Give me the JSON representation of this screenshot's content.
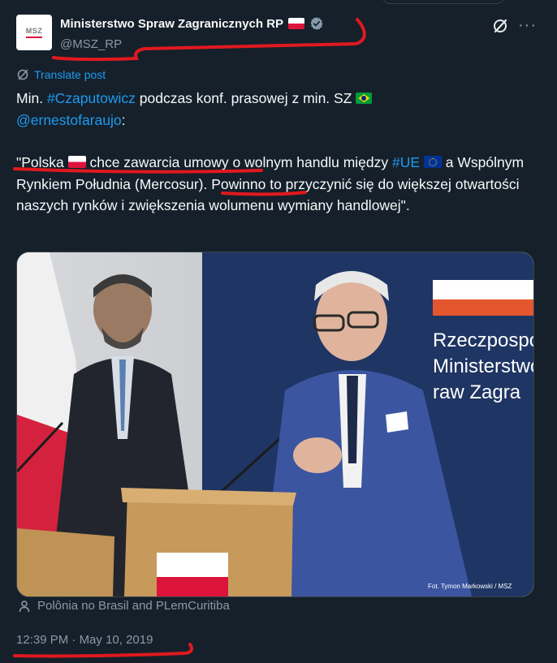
{
  "account": {
    "name": "Ministerstwo Spraw Zagranicznych RP",
    "handle": "@MSZ_RP",
    "avatar_text": "MSZ",
    "verified_icon": "verified-badge-icon"
  },
  "translate_label": "Translate post",
  "tweet": {
    "p1_start": "Min. ",
    "hashtag1": "#Czaputowicz",
    "p1_mid": " podczas konf. prasowej z min. SZ ",
    "mention": "@ernestofaraujo",
    "p1_end": ":",
    "q_open": "\"Polska ",
    "q_1": " chce zawarcia umowy o wolnym handlu między ",
    "hashtag2": "#UE",
    "q_2": " a Wspólnym Rynkiem Południa (Mercosur). Powinno to przyczynić się do większej otwartości naszych rynków i zwiększenia wolumenu wymiany handlowej\"."
  },
  "photo": {
    "banner_lines": [
      "Rzeczpospo",
      "Ministerstwo",
      "raw Zagra"
    ],
    "credit": "Fot. Tymon Markowski / MSZ"
  },
  "tagged": "Polônia no Brasil and PLemCuritiba",
  "timestamp": {
    "time": "12:39 PM",
    "separator": " · ",
    "date": "May 10, 2019"
  },
  "colors": {
    "background": "#15202b",
    "text": "#f7f9f9",
    "muted": "#8b98a5",
    "link": "#1d9bf0",
    "annotation_red": "#e0191e"
  }
}
